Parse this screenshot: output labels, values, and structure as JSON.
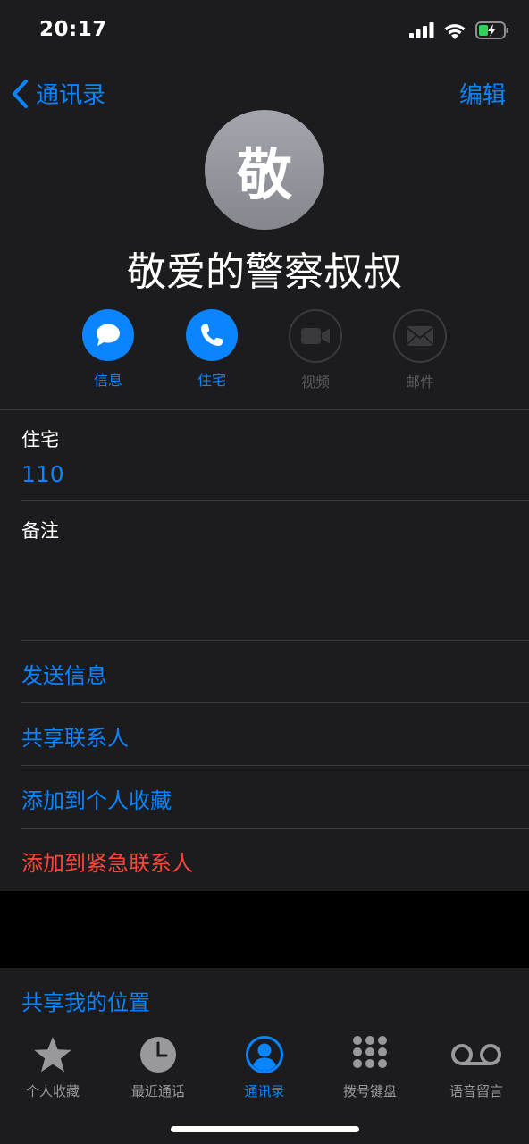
{
  "status": {
    "time": "20:17",
    "icons": [
      "signal-icon",
      "wifi-icon",
      "battery-charging-icon"
    ]
  },
  "nav": {
    "back_label": "通讯录",
    "edit_label": "编辑"
  },
  "contact": {
    "avatar_initial": "敬",
    "name": "敬爱的警察叔叔"
  },
  "actions": [
    {
      "label": "信息",
      "icon": "message-icon",
      "enabled": true
    },
    {
      "label": "住宅",
      "icon": "phone-icon",
      "enabled": true
    },
    {
      "label": "视频",
      "icon": "video-icon",
      "enabled": false
    },
    {
      "label": "邮件",
      "icon": "mail-icon",
      "enabled": false
    }
  ],
  "phone": {
    "label": "住宅",
    "number": "110"
  },
  "notes": {
    "label": "备注"
  },
  "links": {
    "send_message": "发送信息",
    "share_contact": "共享联系人",
    "add_favorites": "添加到个人收藏",
    "add_emergency": "添加到紧急联系人",
    "share_location": "共享我的位置"
  },
  "tabs": [
    {
      "label": "个人收藏",
      "icon": "star-icon",
      "active": false
    },
    {
      "label": "最近通话",
      "icon": "clock-icon",
      "active": false
    },
    {
      "label": "通讯录",
      "icon": "contacts-icon",
      "active": true
    },
    {
      "label": "拨号键盘",
      "icon": "keypad-icon",
      "active": false
    },
    {
      "label": "语音留言",
      "icon": "voicemail-icon",
      "active": false
    }
  ],
  "colors": {
    "accent": "#0a84ff",
    "destructive": "#ff453a",
    "background": "#1c1c1e"
  }
}
